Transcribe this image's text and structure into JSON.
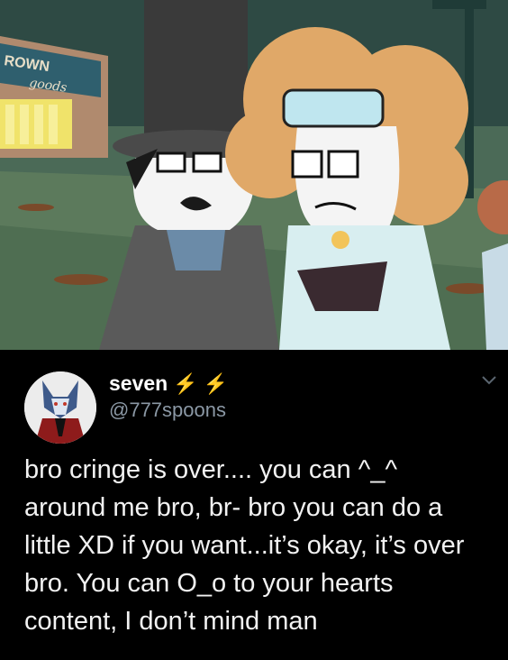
{
  "scene": {
    "storefront_sign": "ROWN",
    "storefront_script": "goods"
  },
  "tweet": {
    "display_name": "seven",
    "name_emoji": [
      "⚡",
      "⚡"
    ],
    "handle": "@777spoons",
    "menu_icon": "chevron-down-icon",
    "lines": [
      "bro cringe is over.... you can ^_^",
      "around me bro, br- bro you can do a",
      "little XD if you want...it’s okay, it’s over",
      "bro. You can O_o to your hearts",
      "content, I don’t mind man"
    ]
  }
}
